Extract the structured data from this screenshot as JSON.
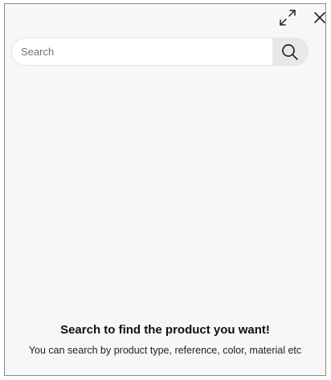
{
  "header": {
    "expand_icon": "expand-icon",
    "close_icon": "close-icon"
  },
  "search": {
    "placeholder": "Search",
    "value": "",
    "button_icon": "search-icon"
  },
  "empty_state": {
    "title": "Search to find the product you want!",
    "subtitle": "You can search by product type, reference, color, material etc"
  },
  "colors": {
    "panel_background": "#f7f7f7",
    "panel_border": "#8a8a8a",
    "search_button_background": "#e8e8e8"
  }
}
